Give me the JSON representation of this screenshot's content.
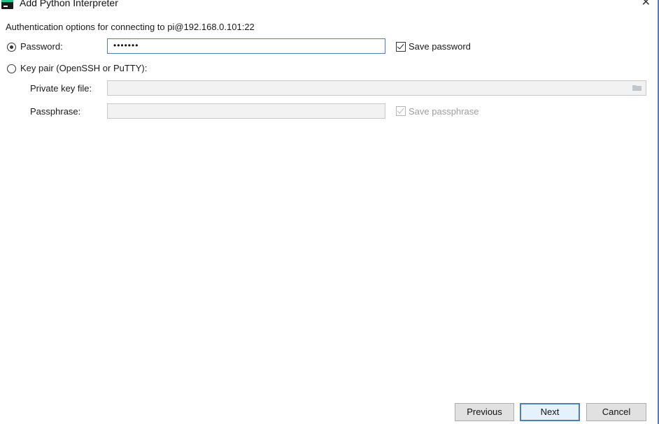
{
  "window": {
    "title": "Add Python Interpreter",
    "close_glyph": "✕",
    "icon": "pycharm-icon"
  },
  "auth": {
    "heading": "Authentication options for connecting to pi@192.168.0.101:22",
    "password_option": "Password:",
    "password_value": "•••••••",
    "save_password": "Save password",
    "keypair_option": "Key pair (OpenSSH or PuTTY):",
    "private_key_label": "Private key file:",
    "passphrase_label": "Passphrase:",
    "save_passphrase": "Save passphrase",
    "selected_method": "password",
    "save_password_checked": true,
    "save_passphrase_checked": true
  },
  "footer": {
    "previous": "Previous",
    "next": "Next",
    "cancel": "Cancel"
  },
  "colors": {
    "accent": "#4a7fc1",
    "disabled_text": "#9e9e9e",
    "disabled_field": "#f2f2f2"
  }
}
